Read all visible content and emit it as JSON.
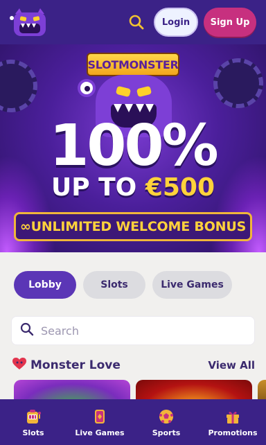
{
  "header": {
    "login_label": "Login",
    "signup_label": "Sign Up",
    "search_icon": "search-icon",
    "logo_icon": "monster-logo-icon"
  },
  "banner": {
    "brand": "SLOTMONSTER",
    "headline": "100%",
    "upto_prefix": "UP TO ",
    "upto_amount": "€500",
    "bonus": "∞UNLIMITED WELCOME BONUS"
  },
  "tabs": [
    {
      "label": "Lobby",
      "active": true
    },
    {
      "label": "Slots",
      "active": false
    },
    {
      "label": "Live Games",
      "active": false
    }
  ],
  "search": {
    "placeholder": "Search"
  },
  "section": {
    "title": "Monster Love",
    "view_all": "View All",
    "icon": "heart-icon"
  },
  "bottom_nav": [
    {
      "label": "Slots",
      "icon": "slot-machine-icon"
    },
    {
      "label": "Live Games",
      "icon": "live-cards-icon"
    },
    {
      "label": "Sports",
      "icon": "soccer-ball-icon"
    },
    {
      "label": "Promotions",
      "icon": "gift-icon"
    }
  ],
  "colors": {
    "brand_purple": "#3b2287",
    "accent_pink": "#c7307f",
    "active_tab": "#5b36b6",
    "gold": "#ffd23b"
  }
}
